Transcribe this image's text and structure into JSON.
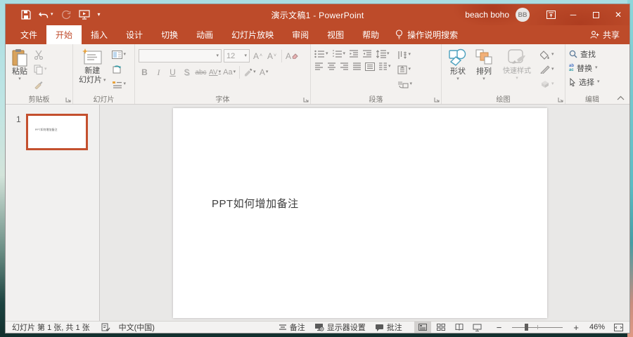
{
  "titlebar": {
    "title": "演示文稿1 - PowerPoint",
    "user_name": "beach boho",
    "avatar_initials": "BB"
  },
  "tabs": {
    "items": [
      "文件",
      "开始",
      "插入",
      "设计",
      "切换",
      "动画",
      "幻灯片放映",
      "审阅",
      "视图",
      "帮助"
    ],
    "active": "开始",
    "tell_me": "操作说明搜索",
    "share": "共享"
  },
  "ribbon": {
    "clipboard": {
      "label": "剪贴板",
      "paste": "粘贴"
    },
    "slides": {
      "label": "幻灯片",
      "new_slide_line1": "新建",
      "new_slide_line2": "幻灯片"
    },
    "font": {
      "label": "字体",
      "font_name": "",
      "font_size": "12",
      "grow": "A",
      "shrink": "A",
      "clear": "A",
      "bold": "B",
      "italic": "I",
      "underline": "U",
      "shadow": "S",
      "strike": "abc",
      "spacing": "AV",
      "case": "Aa",
      "color": "A"
    },
    "paragraph": {
      "label": "段落"
    },
    "drawing": {
      "label": "绘图",
      "shapes": "形状",
      "arrange": "排列",
      "quick_styles": "快速样式"
    },
    "editing": {
      "label": "编辑",
      "find": "查找",
      "replace": "替换",
      "select": "选择",
      "replace_glyph_top": "ab",
      "replace_glyph_bottom": "ac"
    }
  },
  "slide_panel": {
    "slide_number": "1",
    "thumbnail_text": "PPT如何增加备注"
  },
  "canvas": {
    "slide_text": "PPT如何增加备注"
  },
  "status": {
    "slide_info": "幻灯片 第 1 张, 共 1 张",
    "language": "中文(中国)",
    "notes": "备注",
    "display_settings": "显示器设置",
    "comments": "批注",
    "zoom_level": "46%"
  },
  "colors": {
    "titlebar": "#BD4B2A",
    "selected_thumb_border": "#C4502E",
    "active_tab_text": "#C04B2C"
  }
}
